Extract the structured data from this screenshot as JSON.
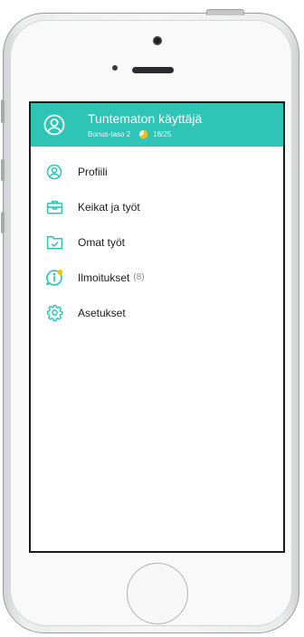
{
  "header": {
    "user_name": "Tuntematon käyttäjä",
    "bonus_level": "Bonus-taso 2",
    "progress_text": "18/25",
    "progress_value": 0.72
  },
  "menu": {
    "items": [
      {
        "label": "Profiili",
        "icon": "user-circle-icon"
      },
      {
        "label": "Keikat ja työt",
        "icon": "briefcase-icon"
      },
      {
        "label": "Omat työt",
        "icon": "folder-check-icon"
      },
      {
        "label": "Ilmoitukset",
        "count": "(8)",
        "icon": "info-bubble-icon"
      },
      {
        "label": "Asetukset",
        "icon": "gear-icon"
      }
    ]
  },
  "colors": {
    "accent": "#2ec4b6",
    "icon": "#2ec4b6",
    "badge": "#f5c400",
    "text": "#1c1c1c",
    "muted": "#8a8a8a"
  }
}
